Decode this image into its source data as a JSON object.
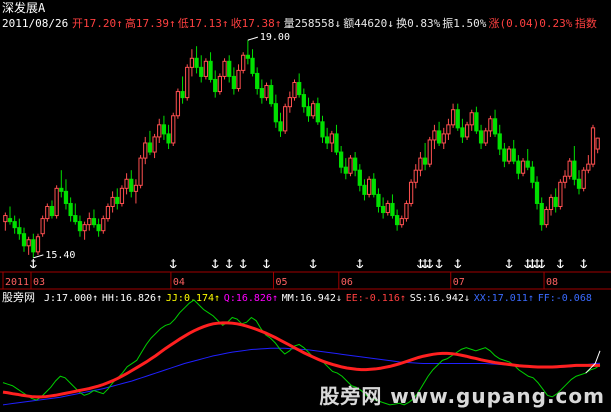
{
  "stock": {
    "name": "深发展A",
    "date": "2011/08/26",
    "fields": [
      {
        "label": "开",
        "value": "17.20",
        "arrow": "↑",
        "color": "#ff4040"
      },
      {
        "label": "高",
        "value": "17.39",
        "arrow": "↑",
        "color": "#ff4040"
      },
      {
        "label": "低",
        "value": "17.13",
        "arrow": "↑",
        "color": "#ff4040"
      },
      {
        "label": "收",
        "value": "17.38",
        "arrow": "↑",
        "color": "#ff4040"
      },
      {
        "label": "量",
        "value": "258558",
        "arrow": "↓",
        "color": "#e8e8e8"
      },
      {
        "label": "额",
        "value": "44620",
        "arrow": "↓",
        "color": "#e8e8e8"
      },
      {
        "label": "换",
        "value": "0.83%",
        "arrow": "",
        "color": "#e8e8e8"
      },
      {
        "label": "振",
        "value": "1.50%",
        "arrow": "",
        "color": "#e8e8e8"
      },
      {
        "label": "涨",
        "value": "(0.04)0.23%",
        "arrow": "",
        "color": "#ff4040"
      },
      {
        "label": "指数",
        "value": "",
        "arrow": "",
        "color": "#ff4040"
      }
    ]
  },
  "indicator": {
    "name": "股旁网",
    "fields": [
      {
        "label": "J:",
        "value": "17.000",
        "arrow": "↑",
        "color": "#ffffff"
      },
      {
        "label": "HH:",
        "value": "16.826",
        "arrow": "↑",
        "color": "#ffffff"
      },
      {
        "label": "JJ:",
        "value": "0.174",
        "arrow": "↑",
        "color": "#ffff00"
      },
      {
        "label": "Q:",
        "value": "16.826",
        "arrow": "↑",
        "color": "#ff00ff"
      },
      {
        "label": "MM:",
        "value": "16.942",
        "arrow": "↓",
        "color": "#ffffff"
      },
      {
        "label": "EE:",
        "value": "-0.116",
        "arrow": "↑",
        "color": "#ff4040"
      },
      {
        "label": "SS:",
        "value": "16.942",
        "arrow": "↓",
        "color": "#ffffff"
      },
      {
        "label": "XX:",
        "value": "17.011",
        "arrow": "↑",
        "color": "#3a6bff"
      },
      {
        "label": "FF:",
        "value": "-0.068",
        "arrow": "",
        "color": "#3a6bff"
      }
    ]
  },
  "watermark": "股旁网 www.gupang.com",
  "colors": {
    "up": "#ff5050",
    "down": "#00e000",
    "axis": "#a00000",
    "label": "#ff6060",
    "green_line": "#00d000",
    "red_line": "#ff2020",
    "blue_line": "#2020ff",
    "white_line": "#ffffff"
  },
  "chart_data": {
    "type": "candlestick",
    "x_ticks": [
      {
        "label": "2011",
        "index": 0
      },
      {
        "label": "03",
        "index": 6
      },
      {
        "label": "04",
        "index": 36
      },
      {
        "label": "05",
        "index": 58
      },
      {
        "label": "06",
        "index": 72
      },
      {
        "label": "07",
        "index": 96
      },
      {
        "label": "08",
        "index": 116
      }
    ],
    "annotations": [
      {
        "text": "19.00",
        "index": 52,
        "price": 19.0
      },
      {
        "text": "15.40",
        "index": 6,
        "price": 15.4
      }
    ],
    "ylim": [
      15.2,
      19.3
    ],
    "candles": [
      [
        16.0,
        16.15,
        15.85,
        16.1
      ],
      [
        16.05,
        16.25,
        15.95,
        16.0
      ],
      [
        16.0,
        16.1,
        15.8,
        15.9
      ],
      [
        15.9,
        16.05,
        15.7,
        15.8
      ],
      [
        15.8,
        15.9,
        15.5,
        15.6
      ],
      [
        15.6,
        15.75,
        15.45,
        15.7
      ],
      [
        15.7,
        15.8,
        15.4,
        15.5
      ],
      [
        15.5,
        15.8,
        15.45,
        15.75
      ],
      [
        15.8,
        16.1,
        15.75,
        16.05
      ],
      [
        16.05,
        16.3,
        16.0,
        16.25
      ],
      [
        16.25,
        16.35,
        16.05,
        16.1
      ],
      [
        16.1,
        16.6,
        16.05,
        16.55
      ],
      [
        16.55,
        16.85,
        16.4,
        16.5
      ],
      [
        16.5,
        16.7,
        16.2,
        16.3
      ],
      [
        16.3,
        16.4,
        16.0,
        16.1
      ],
      [
        16.1,
        16.3,
        15.95,
        16.0
      ],
      [
        16.0,
        16.1,
        15.75,
        15.85
      ],
      [
        15.85,
        16.0,
        15.7,
        15.95
      ],
      [
        15.95,
        16.15,
        15.85,
        16.05
      ],
      [
        16.05,
        16.2,
        15.9,
        15.95
      ],
      [
        15.95,
        16.05,
        15.75,
        15.85
      ],
      [
        15.85,
        16.1,
        15.8,
        16.05
      ],
      [
        16.05,
        16.3,
        16.0,
        16.25
      ],
      [
        16.25,
        16.5,
        16.15,
        16.4
      ],
      [
        16.4,
        16.55,
        16.2,
        16.3
      ],
      [
        16.3,
        16.6,
        16.25,
        16.55
      ],
      [
        16.55,
        16.8,
        16.45,
        16.7
      ],
      [
        16.7,
        16.85,
        16.4,
        16.5
      ],
      [
        16.5,
        16.7,
        16.3,
        16.6
      ],
      [
        16.6,
        17.1,
        16.55,
        17.05
      ],
      [
        17.05,
        17.4,
        16.95,
        17.3
      ],
      [
        17.3,
        17.5,
        17.1,
        17.15
      ],
      [
        17.15,
        17.45,
        17.05,
        17.4
      ],
      [
        17.4,
        17.7,
        17.3,
        17.6
      ],
      [
        17.6,
        17.75,
        17.35,
        17.45
      ],
      [
        17.45,
        17.6,
        17.2,
        17.3
      ],
      [
        17.3,
        17.8,
        17.25,
        17.75
      ],
      [
        17.75,
        18.2,
        17.7,
        18.15
      ],
      [
        18.15,
        18.4,
        17.95,
        18.05
      ],
      [
        18.05,
        18.6,
        18.0,
        18.55
      ],
      [
        18.55,
        18.85,
        18.4,
        18.7
      ],
      [
        18.7,
        18.9,
        18.45,
        18.55
      ],
      [
        18.55,
        18.75,
        18.3,
        18.4
      ],
      [
        18.4,
        18.7,
        18.35,
        18.65
      ],
      [
        18.65,
        18.8,
        18.3,
        18.35
      ],
      [
        18.35,
        18.5,
        18.05,
        18.15
      ],
      [
        18.15,
        18.45,
        18.1,
        18.4
      ],
      [
        18.4,
        18.7,
        18.35,
        18.65
      ],
      [
        18.65,
        18.75,
        18.3,
        18.4
      ],
      [
        18.4,
        18.55,
        18.1,
        18.2
      ],
      [
        18.2,
        18.6,
        18.15,
        18.5
      ],
      [
        18.5,
        18.8,
        18.45,
        18.75
      ],
      [
        18.75,
        19.0,
        18.6,
        18.7
      ],
      [
        18.7,
        18.85,
        18.4,
        18.45
      ],
      [
        18.45,
        18.55,
        18.1,
        18.2
      ],
      [
        18.2,
        18.35,
        17.95,
        18.05
      ],
      [
        18.05,
        18.3,
        18.0,
        18.25
      ],
      [
        18.25,
        18.35,
        17.9,
        17.95
      ],
      [
        17.95,
        18.1,
        17.55,
        17.65
      ],
      [
        17.65,
        17.8,
        17.4,
        17.5
      ],
      [
        17.5,
        17.95,
        17.45,
        17.9
      ],
      [
        17.9,
        18.15,
        17.8,
        18.05
      ],
      [
        18.05,
        18.35,
        18.0,
        18.3
      ],
      [
        18.3,
        18.45,
        18.05,
        18.1
      ],
      [
        18.1,
        18.2,
        17.8,
        17.9
      ],
      [
        17.9,
        18.05,
        17.65,
        17.75
      ],
      [
        17.75,
        18.0,
        17.7,
        17.95
      ],
      [
        17.95,
        18.05,
        17.6,
        17.65
      ],
      [
        17.65,
        17.75,
        17.3,
        17.4
      ],
      [
        17.4,
        17.55,
        17.2,
        17.3
      ],
      [
        17.3,
        17.5,
        17.15,
        17.45
      ],
      [
        17.45,
        17.6,
        17.1,
        17.15
      ],
      [
        17.15,
        17.25,
        16.8,
        16.9
      ],
      [
        16.9,
        17.05,
        16.7,
        16.8
      ],
      [
        16.8,
        17.1,
        16.75,
        17.05
      ],
      [
        17.05,
        17.15,
        16.75,
        16.85
      ],
      [
        16.85,
        16.95,
        16.5,
        16.6
      ],
      [
        16.6,
        16.7,
        16.35,
        16.45
      ],
      [
        16.45,
        16.75,
        16.4,
        16.7
      ],
      [
        16.7,
        16.8,
        16.4,
        16.45
      ],
      [
        16.45,
        16.55,
        16.15,
        16.25
      ],
      [
        16.25,
        16.4,
        16.05,
        16.15
      ],
      [
        16.15,
        16.35,
        16.1,
        16.3
      ],
      [
        16.3,
        16.45,
        16.05,
        16.1
      ],
      [
        16.1,
        16.2,
        15.85,
        15.95
      ],
      [
        15.95,
        16.1,
        15.9,
        16.05
      ],
      [
        16.05,
        16.35,
        16.0,
        16.3
      ],
      [
        16.3,
        16.7,
        16.25,
        16.65
      ],
      [
        16.65,
        16.95,
        16.55,
        16.85
      ],
      [
        16.85,
        17.15,
        16.75,
        17.05
      ],
      [
        17.05,
        17.3,
        16.85,
        16.95
      ],
      [
        16.95,
        17.4,
        16.9,
        17.35
      ],
      [
        17.35,
        17.6,
        17.2,
        17.5
      ],
      [
        17.5,
        17.65,
        17.25,
        17.3
      ],
      [
        17.3,
        17.55,
        17.2,
        17.45
      ],
      [
        17.45,
        17.7,
        17.35,
        17.6
      ],
      [
        17.6,
        17.95,
        17.55,
        17.85
      ],
      [
        17.85,
        17.95,
        17.5,
        17.55
      ],
      [
        17.55,
        17.7,
        17.3,
        17.4
      ],
      [
        17.4,
        17.65,
        17.35,
        17.6
      ],
      [
        17.6,
        17.85,
        17.5,
        17.8
      ],
      [
        17.8,
        17.9,
        17.45,
        17.5
      ],
      [
        17.5,
        17.6,
        17.2,
        17.3
      ],
      [
        17.3,
        17.55,
        17.25,
        17.5
      ],
      [
        17.5,
        17.75,
        17.4,
        17.7
      ],
      [
        17.7,
        17.85,
        17.4,
        17.45
      ],
      [
        17.45,
        17.6,
        17.1,
        17.2
      ],
      [
        17.2,
        17.3,
        16.9,
        17.0
      ],
      [
        17.0,
        17.25,
        16.95,
        17.2
      ],
      [
        17.2,
        17.35,
        16.95,
        17.0
      ],
      [
        17.0,
        17.1,
        16.7,
        16.8
      ],
      [
        16.8,
        17.05,
        16.75,
        17.0
      ],
      [
        17.0,
        17.2,
        16.85,
        16.9
      ],
      [
        16.9,
        17.0,
        16.55,
        16.65
      ],
      [
        16.65,
        16.75,
        16.2,
        16.3
      ],
      [
        16.3,
        16.4,
        15.85,
        15.95
      ],
      [
        15.95,
        16.25,
        15.9,
        16.2
      ],
      [
        16.2,
        16.45,
        16.1,
        16.4
      ],
      [
        16.4,
        16.55,
        16.15,
        16.25
      ],
      [
        16.25,
        16.7,
        16.2,
        16.65
      ],
      [
        16.65,
        16.85,
        16.55,
        16.75
      ],
      [
        16.75,
        17.05,
        16.7,
        17.0
      ],
      [
        17.0,
        17.25,
        16.6,
        16.7
      ],
      [
        16.7,
        16.85,
        16.45,
        16.55
      ],
      [
        16.55,
        16.9,
        16.5,
        16.85
      ],
      [
        16.85,
        17.1,
        16.8,
        16.95
      ],
      [
        16.95,
        17.6,
        16.9,
        17.55
      ],
      [
        17.2,
        17.39,
        17.13,
        17.38
      ]
    ],
    "markers": [
      6,
      36,
      45,
      48,
      51,
      56,
      66,
      76,
      89,
      90,
      91,
      93,
      97,
      108,
      112,
      113,
      114,
      115,
      119,
      124
    ],
    "indicator": {
      "ylim": [
        15.6,
        19.0
      ],
      "red": [
        16.1,
        16.08,
        16.05,
        16.03,
        16.0,
        15.98,
        15.96,
        15.95,
        15.95,
        15.96,
        15.98,
        16.0,
        16.03,
        16.06,
        16.09,
        16.12,
        16.15,
        16.18,
        16.21,
        16.25,
        16.29,
        16.34,
        16.4,
        16.46,
        16.53,
        16.61,
        16.69,
        16.78,
        16.87,
        16.96,
        17.05,
        17.15,
        17.25,
        17.36,
        17.47,
        17.57,
        17.67,
        17.77,
        17.86,
        17.95,
        18.03,
        18.1,
        18.16,
        18.21,
        18.25,
        18.27,
        18.28,
        18.28,
        18.27,
        18.25,
        18.22,
        18.18,
        18.13,
        18.08,
        18.02,
        17.96,
        17.89,
        17.82,
        17.74,
        17.66,
        17.58,
        17.5,
        17.42,
        17.34,
        17.27,
        17.2,
        17.13,
        17.07,
        17.02,
        16.97,
        16.93,
        16.89,
        16.86,
        16.84,
        16.82,
        16.81,
        16.81,
        16.82,
        16.83,
        16.85,
        16.88,
        16.91,
        16.95,
        16.99,
        17.04,
        17.09,
        17.14,
        17.19,
        17.23,
        17.26,
        17.29,
        17.31,
        17.32,
        17.32,
        17.31,
        17.29,
        17.26,
        17.23,
        17.19,
        17.16,
        17.12,
        17.09,
        17.06,
        17.03,
        17.01,
        16.99,
        16.97,
        16.95,
        16.93,
        16.92,
        16.91,
        16.9,
        16.89,
        16.89,
        16.89,
        16.89,
        16.9,
        16.91,
        16.92,
        16.93,
        16.94,
        16.94,
        16.94,
        16.94,
        16.94,
        16.94
      ],
      "green": [
        16.4,
        16.35,
        16.3,
        16.2,
        16.1,
        16.0,
        15.9,
        15.85,
        15.95,
        16.1,
        16.25,
        16.45,
        16.6,
        16.55,
        16.4,
        16.25,
        16.1,
        16.0,
        16.05,
        16.15,
        16.1,
        16.05,
        16.2,
        16.4,
        16.55,
        16.7,
        16.9,
        17.0,
        17.1,
        17.35,
        17.6,
        17.8,
        17.95,
        18.1,
        18.2,
        18.25,
        18.4,
        18.6,
        18.75,
        18.9,
        19.0,
        18.85,
        18.7,
        18.6,
        18.5,
        18.35,
        18.2,
        18.3,
        18.45,
        18.4,
        18.25,
        18.3,
        18.45,
        18.35,
        18.1,
        17.9,
        17.8,
        17.65,
        17.45,
        17.3,
        17.4,
        17.55,
        17.6,
        17.5,
        17.35,
        17.2,
        17.15,
        17.05,
        16.9,
        16.75,
        16.7,
        16.6,
        16.45,
        16.3,
        16.25,
        16.15,
        16.0,
        15.9,
        15.85,
        15.8,
        15.75,
        15.7,
        15.72,
        15.75,
        15.7,
        15.78,
        15.9,
        16.1,
        16.35,
        16.6,
        16.8,
        16.95,
        17.1,
        17.15,
        17.25,
        17.35,
        17.45,
        17.5,
        17.45,
        17.4,
        17.45,
        17.5,
        17.4,
        17.25,
        17.15,
        17.1,
        17.05,
        16.95,
        16.8,
        16.7,
        16.6,
        16.55,
        16.4,
        16.2,
        16.0,
        15.95,
        16.05,
        16.2,
        16.35,
        16.5,
        16.6,
        16.65,
        16.7,
        16.8,
        16.85,
        16.95
      ],
      "blue": [
        15.7,
        15.72,
        15.74,
        15.76,
        15.78,
        15.8,
        15.82,
        15.84,
        15.86,
        15.88,
        15.9,
        15.92,
        15.94,
        15.97,
        16.0,
        16.03,
        16.06,
        16.09,
        16.12,
        16.15,
        16.18,
        16.21,
        16.25,
        16.29,
        16.33,
        16.37,
        16.41,
        16.45,
        16.5,
        16.55,
        16.6,
        16.65,
        16.7,
        16.75,
        16.8,
        16.85,
        16.9,
        16.95,
        17.0,
        17.04,
        17.08,
        17.12,
        17.16,
        17.2,
        17.24,
        17.27,
        17.3,
        17.33,
        17.36,
        17.38,
        17.4,
        17.42,
        17.44,
        17.45,
        17.46,
        17.47,
        17.48,
        17.48,
        17.48,
        17.48,
        17.47,
        17.46,
        17.45,
        17.44,
        17.43,
        17.41,
        17.39,
        17.37,
        17.35,
        17.33,
        17.31,
        17.29,
        17.27,
        17.25,
        17.23,
        17.21,
        17.19,
        17.17,
        17.15,
        17.13,
        17.11,
        17.09,
        17.07,
        17.05,
        17.04,
        17.03,
        17.02,
        17.01,
        17.0,
        17.0,
        17.0,
        17.0,
        17.0,
        17.0,
        17.0,
        17.0,
        17.0,
        17.0,
        17.0,
        17.0,
        17.0,
        17.0,
        16.99,
        16.98,
        16.97,
        16.96,
        16.95,
        16.94,
        16.93,
        16.92,
        16.91,
        16.9,
        16.89,
        16.88,
        16.87,
        16.87,
        16.87,
        16.88,
        16.89,
        16.9,
        16.92,
        16.94,
        16.96,
        16.98,
        17.0,
        17.01
      ],
      "white_tail": [
        16.7,
        16.85,
        17.0,
        17.4
      ]
    }
  }
}
